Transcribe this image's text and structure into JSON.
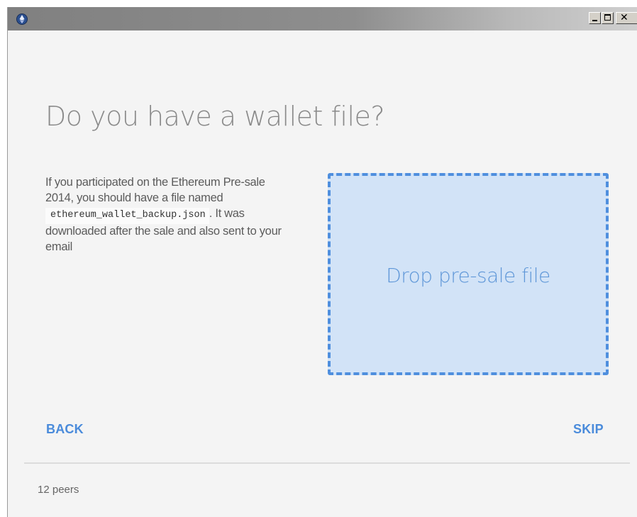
{
  "window": {
    "icon": "ethereum-icon",
    "controls": {
      "minimize": "minimize-icon",
      "maximize": "maximize-icon",
      "close": "close-icon"
    }
  },
  "main": {
    "title": "Do you have a wallet file?",
    "description": {
      "line_before_code": "If you participated on the Ethereum Pre-sale 2014, you should have a file named",
      "filename": "ethereum_wallet_backup.json",
      "line_after_code": ". It was downloaded after the sale and also sent to your email"
    },
    "dropzone": {
      "label": "Drop pre-sale file"
    }
  },
  "footer": {
    "back_label": "BACK",
    "skip_label": "SKIP"
  },
  "status": {
    "peers": "12 peers"
  },
  "colors": {
    "accent": "#4a8bdb",
    "dropzone_bg": "#d2e3f7",
    "heading": "#8a8a8a",
    "background": "#f4f4f4"
  }
}
